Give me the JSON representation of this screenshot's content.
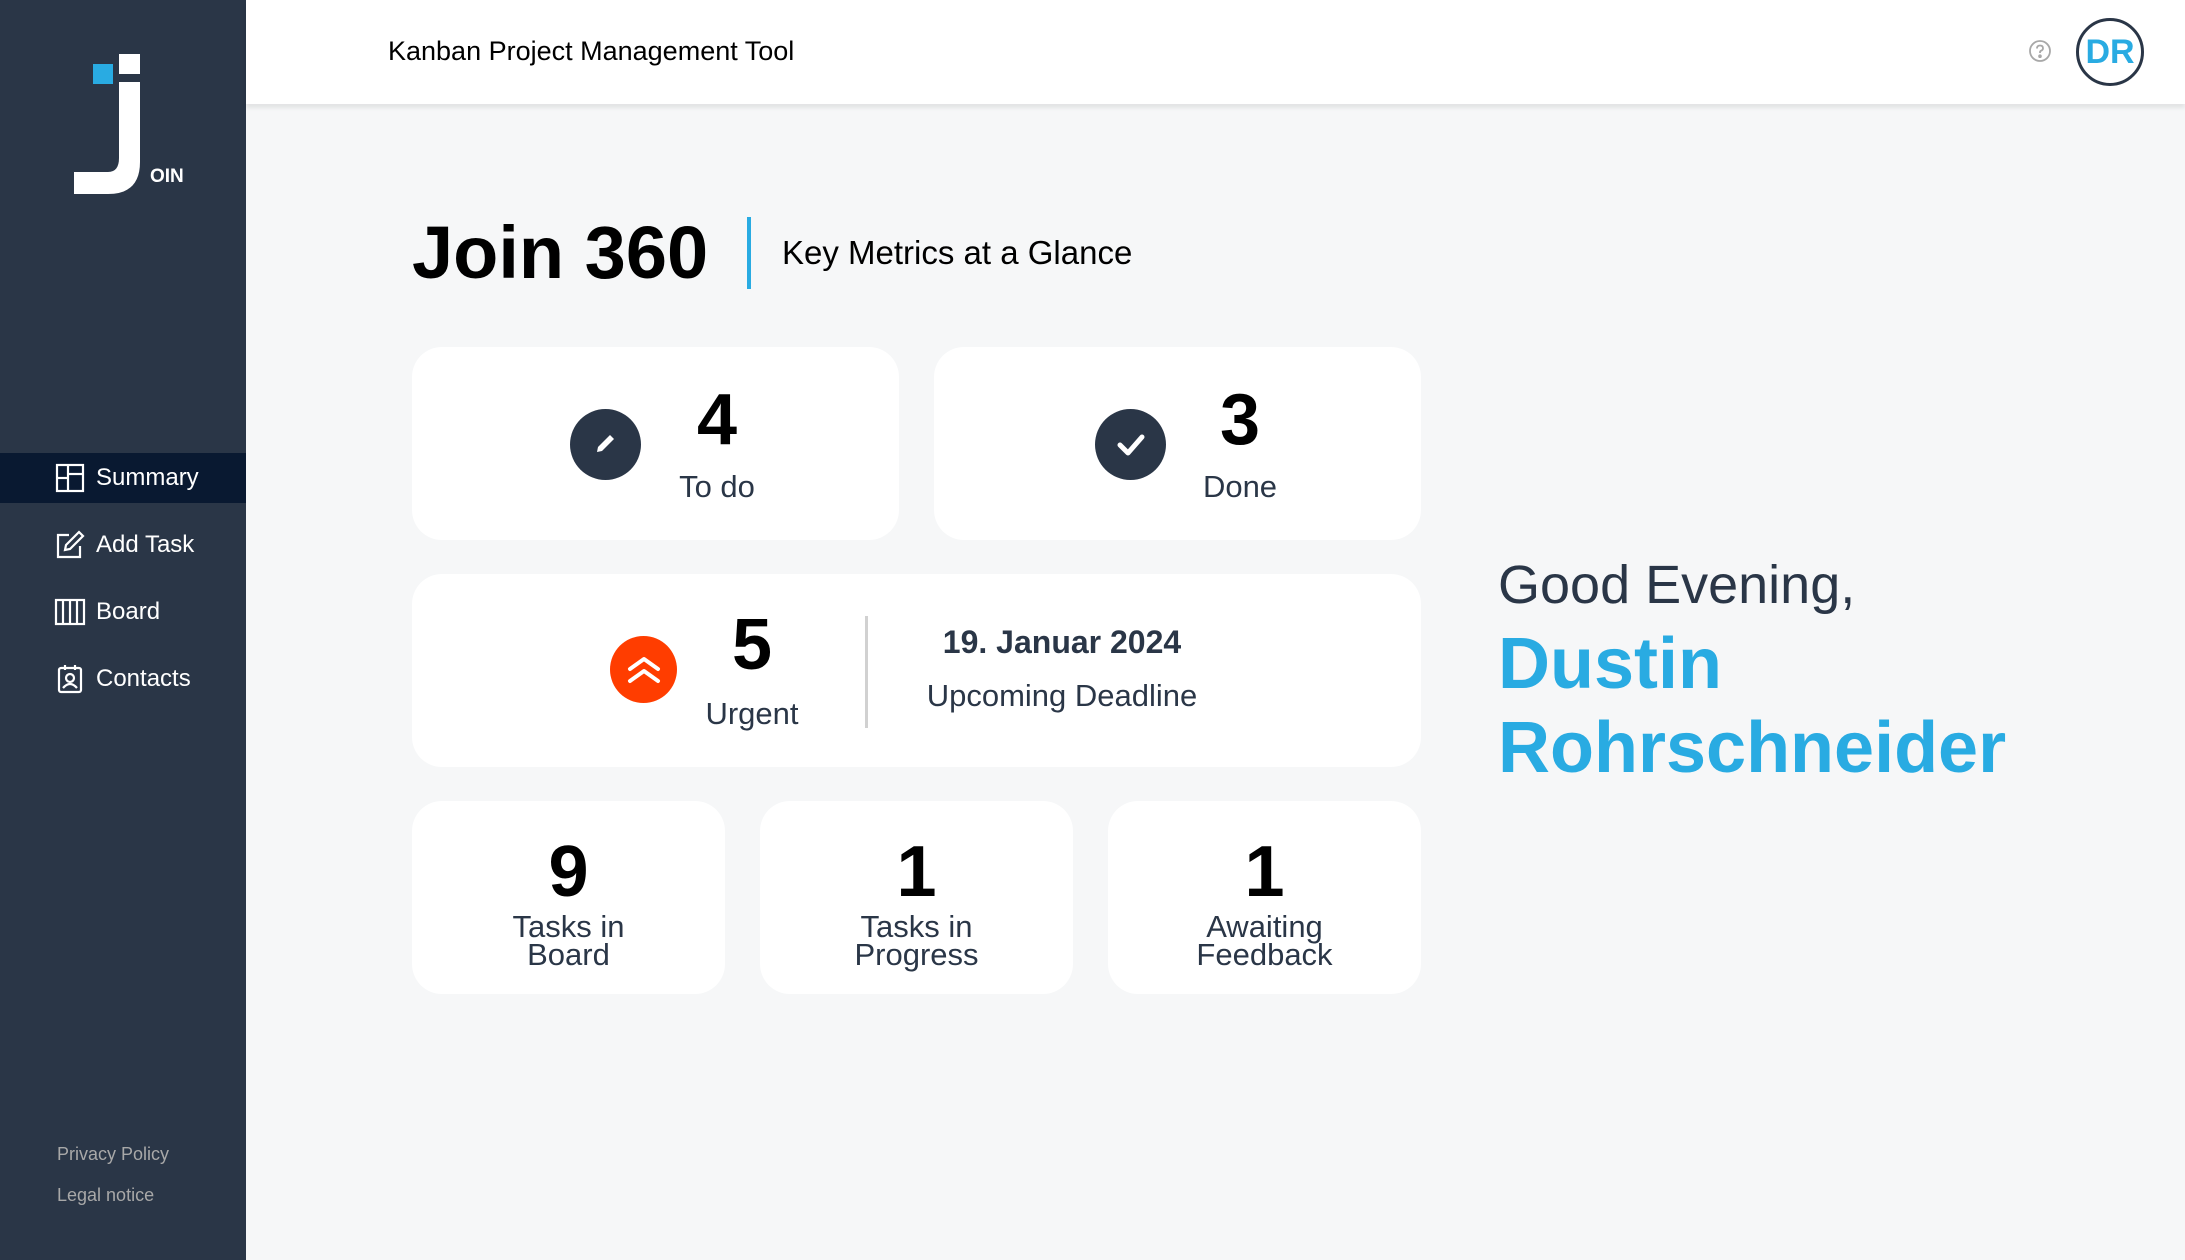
{
  "app": {
    "logo_text": "OIN",
    "header_title": "Kanban Project Management Tool",
    "user_initials": "DR"
  },
  "sidebar": {
    "items": [
      {
        "label": "Summary",
        "icon": "summary-icon",
        "active": true
      },
      {
        "label": "Add Task",
        "icon": "add-task-icon",
        "active": false
      },
      {
        "label": "Board",
        "icon": "board-icon",
        "active": false
      },
      {
        "label": "Contacts",
        "icon": "contacts-icon",
        "active": false
      }
    ],
    "footer": {
      "privacy": "Privacy Policy",
      "legal": "Legal notice"
    }
  },
  "summary": {
    "title": "Join 360",
    "subtitle": "Key Metrics at a Glance",
    "todo": {
      "count": "4",
      "label": "To do"
    },
    "done": {
      "count": "3",
      "label": "Done"
    },
    "urgent": {
      "count": "5",
      "label": "Urgent"
    },
    "deadline": {
      "date": "19. Januar 2024",
      "label": "Upcoming Deadline"
    },
    "tasks_in_board": {
      "count": "9",
      "label_line1": "Tasks in",
      "label_line2": "Board"
    },
    "tasks_in_progress": {
      "count": "1",
      "label_line1": "Tasks in",
      "label_line2": "Progress"
    },
    "awaiting_feedback": {
      "count": "1",
      "label_line1": "Awaiting",
      "label_line2": "Feedback"
    }
  },
  "greeting": {
    "text": "Good Evening,",
    "name": "Dustin Rohrschneider"
  },
  "colors": {
    "sidebar_bg": "#2a3647",
    "sidebar_active": "#091931",
    "accent": "#29abe2",
    "urgent": "#ff3d00",
    "page_bg": "#f6f7f8"
  }
}
